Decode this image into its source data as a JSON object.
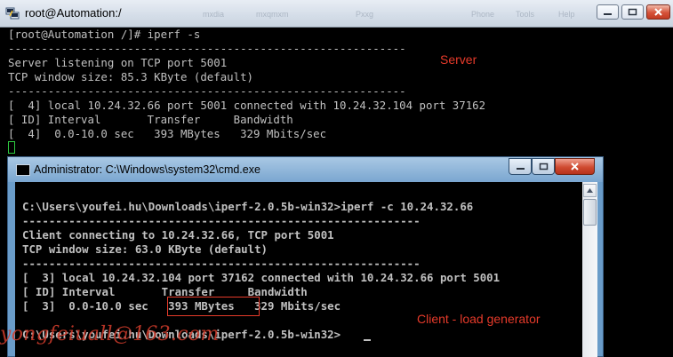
{
  "putty": {
    "title": "root@Automation:/",
    "ghost_menu": [
      "mxdia",
      "mxqmxm",
      "Pxxg",
      "Phone",
      "Tools",
      "Help"
    ],
    "lines": [
      "[root@Automation /]# iperf -s",
      "------------------------------------------------------------",
      "Server listening on TCP port 5001",
      "TCP window size: 85.3 KByte (default)",
      "------------------------------------------------------------",
      "[  4] local 10.24.32.66 port 5001 connected with 10.24.32.104 port 37162",
      "[ ID] Interval       Transfer     Bandwidth",
      "[  4]  0.0-10.0 sec   393 MBytes   329 Mbits/sec"
    ],
    "annotation": "Server"
  },
  "cmd": {
    "title": "Administrator: C:\\Windows\\system32\\cmd.exe",
    "lines": [
      "C:\\Users\\youfei.hu\\Downloads\\iperf-2.0.5b-win32>iperf -c 10.24.32.66",
      "------------------------------------------------------------",
      "Client connecting to 10.24.32.66, TCP port 5001",
      "TCP window size: 63.0 KByte (default)",
      "------------------------------------------------------------",
      "[  3] local 10.24.32.104 port 37162 connected with 10.24.32.66 port 5001",
      "[ ID] Interval       Transfer     Bandwidth",
      "[  3]  0.0-10.0 sec   393 MBytes   329 Mbits/sec",
      "",
      "C:\\Users\\youfei.hu\\Downloads\\iperf-2.0.5b-win32>"
    ],
    "annotation": "Client - load generator",
    "watermark": "yongfeiuall@163.com"
  },
  "colors": {
    "terminal_text": "#c0c0c0",
    "annotation_red": "#e53a2a",
    "cursor_green": "#2ecc40"
  }
}
